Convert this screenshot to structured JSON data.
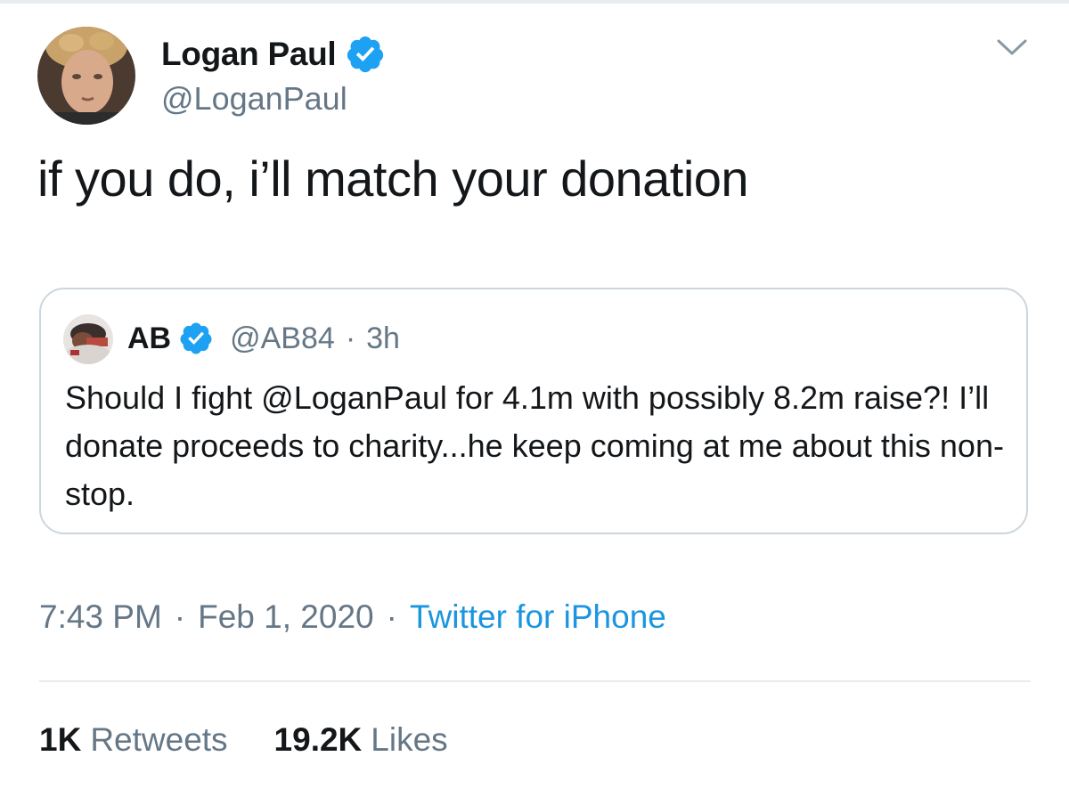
{
  "author": {
    "name": "Logan Paul",
    "handle": "@LoganPaul",
    "verified": true,
    "avatar_icon": "user-avatar-photo"
  },
  "tweet": {
    "text": "if you do, i’ll match your donation",
    "menu_icon": "chevron-down-icon"
  },
  "quoted_tweet": {
    "name": "AB",
    "handle": "@AB84",
    "dot": "·",
    "time": "3h",
    "verified": true,
    "text": "Should I fight @LoganPaul for 4.1m with possibly 8.2m raise?! I’ll donate proceeds to charity...he keep coming at me about this non-stop."
  },
  "meta": {
    "time": "7:43 PM",
    "sep1": "·",
    "date": "Feb 1, 2020",
    "sep2": "·",
    "source": "Twitter for iPhone"
  },
  "stats": {
    "retweets_count": "1K",
    "retweets_label": "Retweets",
    "likes_count": "19.2K",
    "likes_label": "Likes"
  },
  "colors": {
    "text": "#14171a",
    "secondary": "#657786",
    "link": "#1b95e0",
    "verified_badge": "#1da1f2",
    "border": "#ccd6dd"
  }
}
